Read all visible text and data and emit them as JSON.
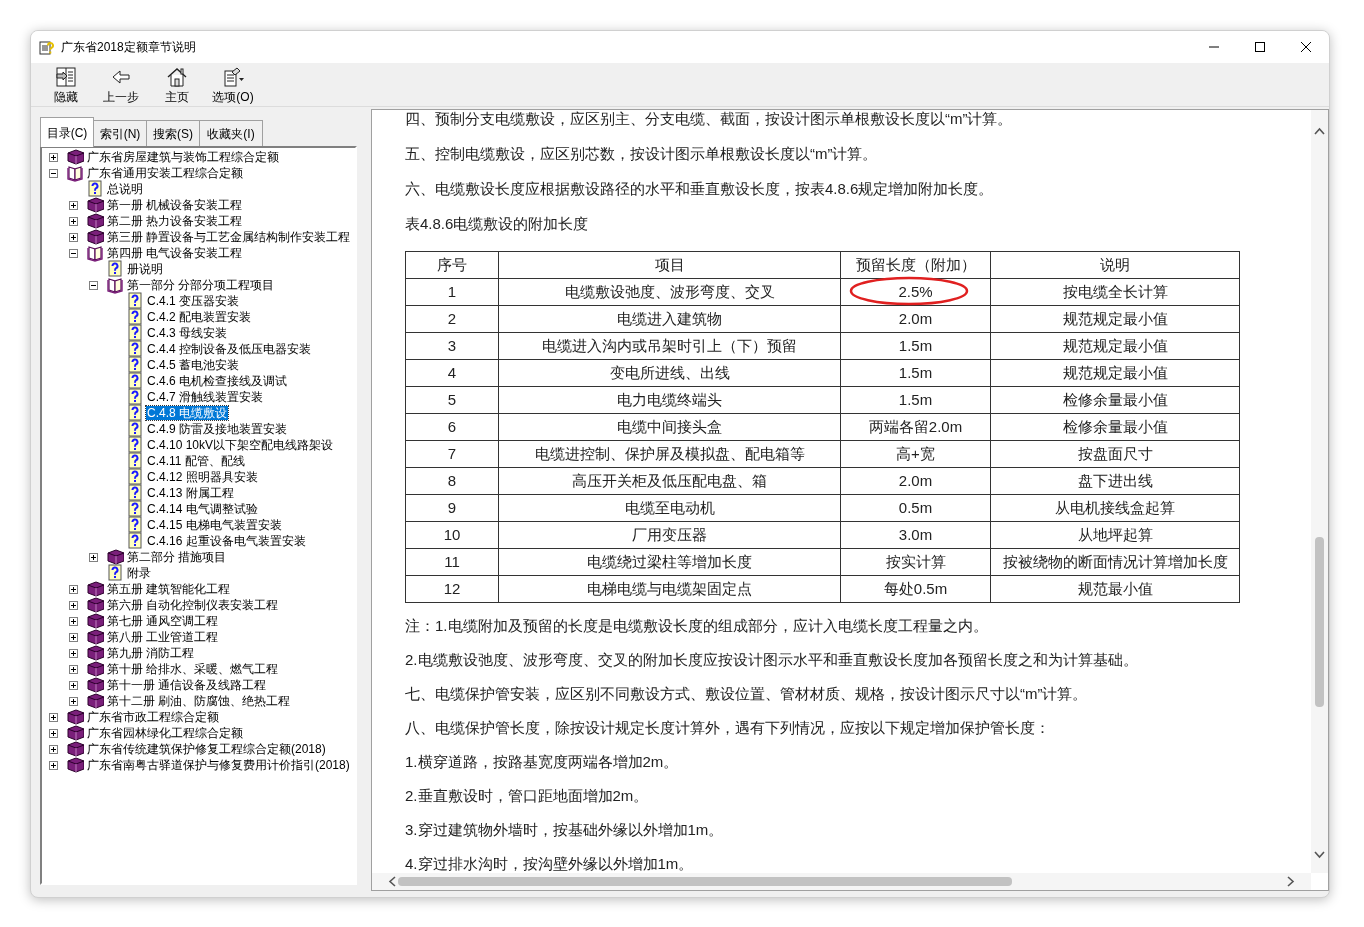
{
  "window": {
    "title": "广东省2018定额章节说明"
  },
  "toolbar": [
    {
      "kind": "hide",
      "label": "隐藏"
    },
    {
      "kind": "back",
      "label": "上一步"
    },
    {
      "kind": "home",
      "label": "主页"
    },
    {
      "kind": "options",
      "label": "选项(O)"
    }
  ],
  "tabs": [
    {
      "label": "目录(C)",
      "selected": true
    },
    {
      "label": "索引(N)",
      "selected": false
    },
    {
      "label": "搜索(S)",
      "selected": false
    },
    {
      "label": "收藏夹(I)",
      "selected": false
    }
  ],
  "tree": [
    {
      "kind": "book",
      "label": "广东省房屋建筑与装饰工程综合定额",
      "expanded": false,
      "selected": false
    },
    {
      "kind": "book",
      "label": "广东省通用安装工程综合定额",
      "expanded": true,
      "selected": false,
      "children": [
        {
          "kind": "page",
          "label": "总说明",
          "selected": false
        },
        {
          "kind": "book",
          "label": "第一册  机械设备安装工程",
          "expanded": false,
          "selected": false
        },
        {
          "kind": "book",
          "label": "第二册  热力设备安装工程",
          "expanded": false,
          "selected": false
        },
        {
          "kind": "book",
          "label": "第三册  静置设备与工艺金属结构制作安装工程",
          "expanded": false,
          "selected": false
        },
        {
          "kind": "book",
          "label": "第四册  电气设备安装工程",
          "expanded": true,
          "selected": false,
          "children": [
            {
              "kind": "page",
              "label": "册说明",
              "selected": false
            },
            {
              "kind": "book",
              "label": "第一部分  分部分项工程项目",
              "expanded": true,
              "selected": false,
              "children": [
                {
                  "kind": "page",
                  "label": "C.4.1 变压器安装",
                  "selected": false
                },
                {
                  "kind": "page",
                  "label": "C.4.2 配电装置安装",
                  "selected": false
                },
                {
                  "kind": "page",
                  "label": "C.4.3 母线安装",
                  "selected": false
                },
                {
                  "kind": "page",
                  "label": "C.4.4 控制设备及低压电器安装",
                  "selected": false
                },
                {
                  "kind": "page",
                  "label": "C.4.5 蓄电池安装",
                  "selected": false
                },
                {
                  "kind": "page",
                  "label": "C.4.6 电机检查接线及调试",
                  "selected": false
                },
                {
                  "kind": "page",
                  "label": "C.4.7 滑触线装置安装",
                  "selected": false
                },
                {
                  "kind": "page",
                  "label": "C.4.8 电缆敷设",
                  "selected": true
                },
                {
                  "kind": "page",
                  "label": "C.4.9 防雷及接地装置安装",
                  "selected": false
                },
                {
                  "kind": "page",
                  "label": "C.4.10 10kV以下架空配电线路架设",
                  "selected": false
                },
                {
                  "kind": "page",
                  "label": "C.4.11 配管、配线",
                  "selected": false
                },
                {
                  "kind": "page",
                  "label": "C.4.12 照明器具安装",
                  "selected": false
                },
                {
                  "kind": "page",
                  "label": "C.4.13 附属工程",
                  "selected": false
                },
                {
                  "kind": "page",
                  "label": "C.4.14 电气调整试验",
                  "selected": false
                },
                {
                  "kind": "page",
                  "label": "C.4.15 电梯电气装置安装",
                  "selected": false
                },
                {
                  "kind": "page",
                  "label": "C.4.16 起重设备电气装置安装",
                  "selected": false
                }
              ]
            },
            {
              "kind": "book",
              "label": "第二部分  措施项目",
              "expanded": false,
              "selected": false
            },
            {
              "kind": "page",
              "label": "附录",
              "selected": false
            }
          ]
        },
        {
          "kind": "book",
          "label": "第五册  建筑智能化工程",
          "expanded": false,
          "selected": false
        },
        {
          "kind": "book",
          "label": "第六册  自动化控制仪表安装工程",
          "expanded": false,
          "selected": false
        },
        {
          "kind": "book",
          "label": "第七册  通风空调工程",
          "expanded": false,
          "selected": false
        },
        {
          "kind": "book",
          "label": "第八册  工业管道工程",
          "expanded": false,
          "selected": false
        },
        {
          "kind": "book",
          "label": "第九册  消防工程",
          "expanded": false,
          "selected": false
        },
        {
          "kind": "book",
          "label": "第十册  给排水、采暖、燃气工程",
          "expanded": false,
          "selected": false
        },
        {
          "kind": "book",
          "label": "第十一册  通信设备及线路工程",
          "expanded": false,
          "selected": false
        },
        {
          "kind": "book",
          "label": "第十二册  刷油、防腐蚀、绝热工程",
          "expanded": false,
          "selected": false
        }
      ]
    },
    {
      "kind": "book",
      "label": "广东省市政工程综合定额",
      "expanded": false,
      "selected": false
    },
    {
      "kind": "book",
      "label": "广东省园林绿化工程综合定额",
      "expanded": false,
      "selected": false
    },
    {
      "kind": "book",
      "label": "广东省传统建筑保护修复工程综合定额(2018)",
      "expanded": false,
      "selected": false
    },
    {
      "kind": "book",
      "label": "广东省南粤古驿道保护与修复费用计价指引(2018)",
      "expanded": false,
      "selected": false
    }
  ],
  "content": {
    "paragraphs_before": [
      "四、预制分支电缆敷设，应区别主、分支电缆、截面，按设计图示单根敷设长度以“m”计算。",
      "五、控制电缆敷设，应区别芯数，按设计图示单根敷设长度以“m”计算。",
      "六、电缆敷设长度应根据敷设路径的水平和垂直敷设长度，按表4.8.6规定增加附加长度。",
      "表4.8.6电缆敷设的附加长度"
    ],
    "table": {
      "columns": [
        "序号",
        "项目",
        "预留长度（附加）",
        "说明"
      ],
      "rows": [
        {
          "cells": [
            "1",
            "电缆敷设弛度、波形弯度、交叉",
            "2.5%",
            "按电缆全长计算"
          ],
          "circled": true
        },
        {
          "cells": [
            "2",
            "电缆进入建筑物",
            "2.0m",
            "规范规定最小值"
          ],
          "circled": false
        },
        {
          "cells": [
            "3",
            "电缆进入沟内或吊架时引上（下）预留",
            "1.5m",
            "规范规定最小值"
          ],
          "circled": false
        },
        {
          "cells": [
            "4",
            "变电所进线、出线",
            "1.5m",
            "规范规定最小值"
          ],
          "circled": false
        },
        {
          "cells": [
            "5",
            "电力电缆终端头",
            "1.5m",
            "检修余量最小值"
          ],
          "circled": false
        },
        {
          "cells": [
            "6",
            "电缆中间接头盒",
            "两端各留2.0m",
            "检修余量最小值"
          ],
          "circled": false
        },
        {
          "cells": [
            "7",
            "电缆进控制、保护屏及模拟盘、配电箱等",
            "高+宽",
            "按盘面尺寸"
          ],
          "circled": false
        },
        {
          "cells": [
            "8",
            "高压开关柜及低压配电盘、箱",
            "2.0m",
            "盘下进出线"
          ],
          "circled": false
        },
        {
          "cells": [
            "9",
            "电缆至电动机",
            "0.5m",
            "从电机接线盒起算"
          ],
          "circled": false
        },
        {
          "cells": [
            "10",
            "厂用变压器",
            "3.0m",
            "从地坪起算"
          ],
          "circled": false
        },
        {
          "cells": [
            "11",
            "电缆绕过梁柱等增加长度",
            "按实计算",
            "按被绕物的断面情况计算增加长度"
          ],
          "circled": false
        },
        {
          "cells": [
            "12",
            "电梯电缆与电缆架固定点",
            "每处0.5m",
            "规范最小值"
          ],
          "circled": false
        }
      ]
    },
    "paragraphs_after": [
      "注：1.电缆附加及预留的长度是电缆敷设长度的组成部分，应计入电缆长度工程量之内。",
      "2.电缆敷设弛度、波形弯度、交叉的附加长度应按设计图示水平和垂直敷设长度加各预留长度之和为计算基础。",
      "七、电缆保护管安装，应区别不同敷设方式、敷设位置、管材材质、规格，按设计图示尺寸以“m”计算。",
      "八、电缆保护管长度，除按设计规定长度计算外，遇有下列情况，应按以下规定增加保护管长度：",
      "1.横穿道路，按路基宽度两端各增加2m。",
      "2.垂直敷设时，管口距地面增加2m。",
      "3.穿过建筑物外墙时，按基础外缘以外增加1m。",
      "4.穿过排水沟时，按沟壁外缘以外增加1m。"
    ]
  }
}
